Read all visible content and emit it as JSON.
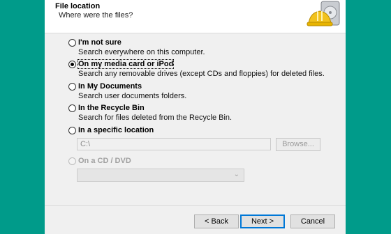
{
  "header": {
    "title": "File location",
    "subtitle": "Where were the files?",
    "icon": "hard-drive-with-hard-hat-icon"
  },
  "options": [
    {
      "label": "I'm not sure",
      "description": "Search everywhere on this computer.",
      "selected": false,
      "enabled": true
    },
    {
      "label": "On my media card or iPod",
      "description": "Search any removable drives (except CDs and floppies) for deleted files.",
      "selected": true,
      "enabled": true
    },
    {
      "label": "In My Documents",
      "description": "Search user documents folders.",
      "selected": false,
      "enabled": true
    },
    {
      "label": "In the Recycle Bin",
      "description": "Search for files deleted from the Recycle Bin.",
      "selected": false,
      "enabled": true
    },
    {
      "label": "In a specific location",
      "description": "",
      "selected": false,
      "enabled": true
    },
    {
      "label": "On a CD / DVD",
      "description": "",
      "selected": false,
      "enabled": false
    }
  ],
  "location": {
    "value": "C:\\",
    "browse_label": "Browse..."
  },
  "cd_select": {
    "value": ""
  },
  "buttons": {
    "back": "< Back",
    "next": "Next >",
    "cancel": "Cancel"
  },
  "colors": {
    "background": "#009b8a",
    "dialog": "#f0f0f0",
    "default_button_border": "#0078d7"
  }
}
